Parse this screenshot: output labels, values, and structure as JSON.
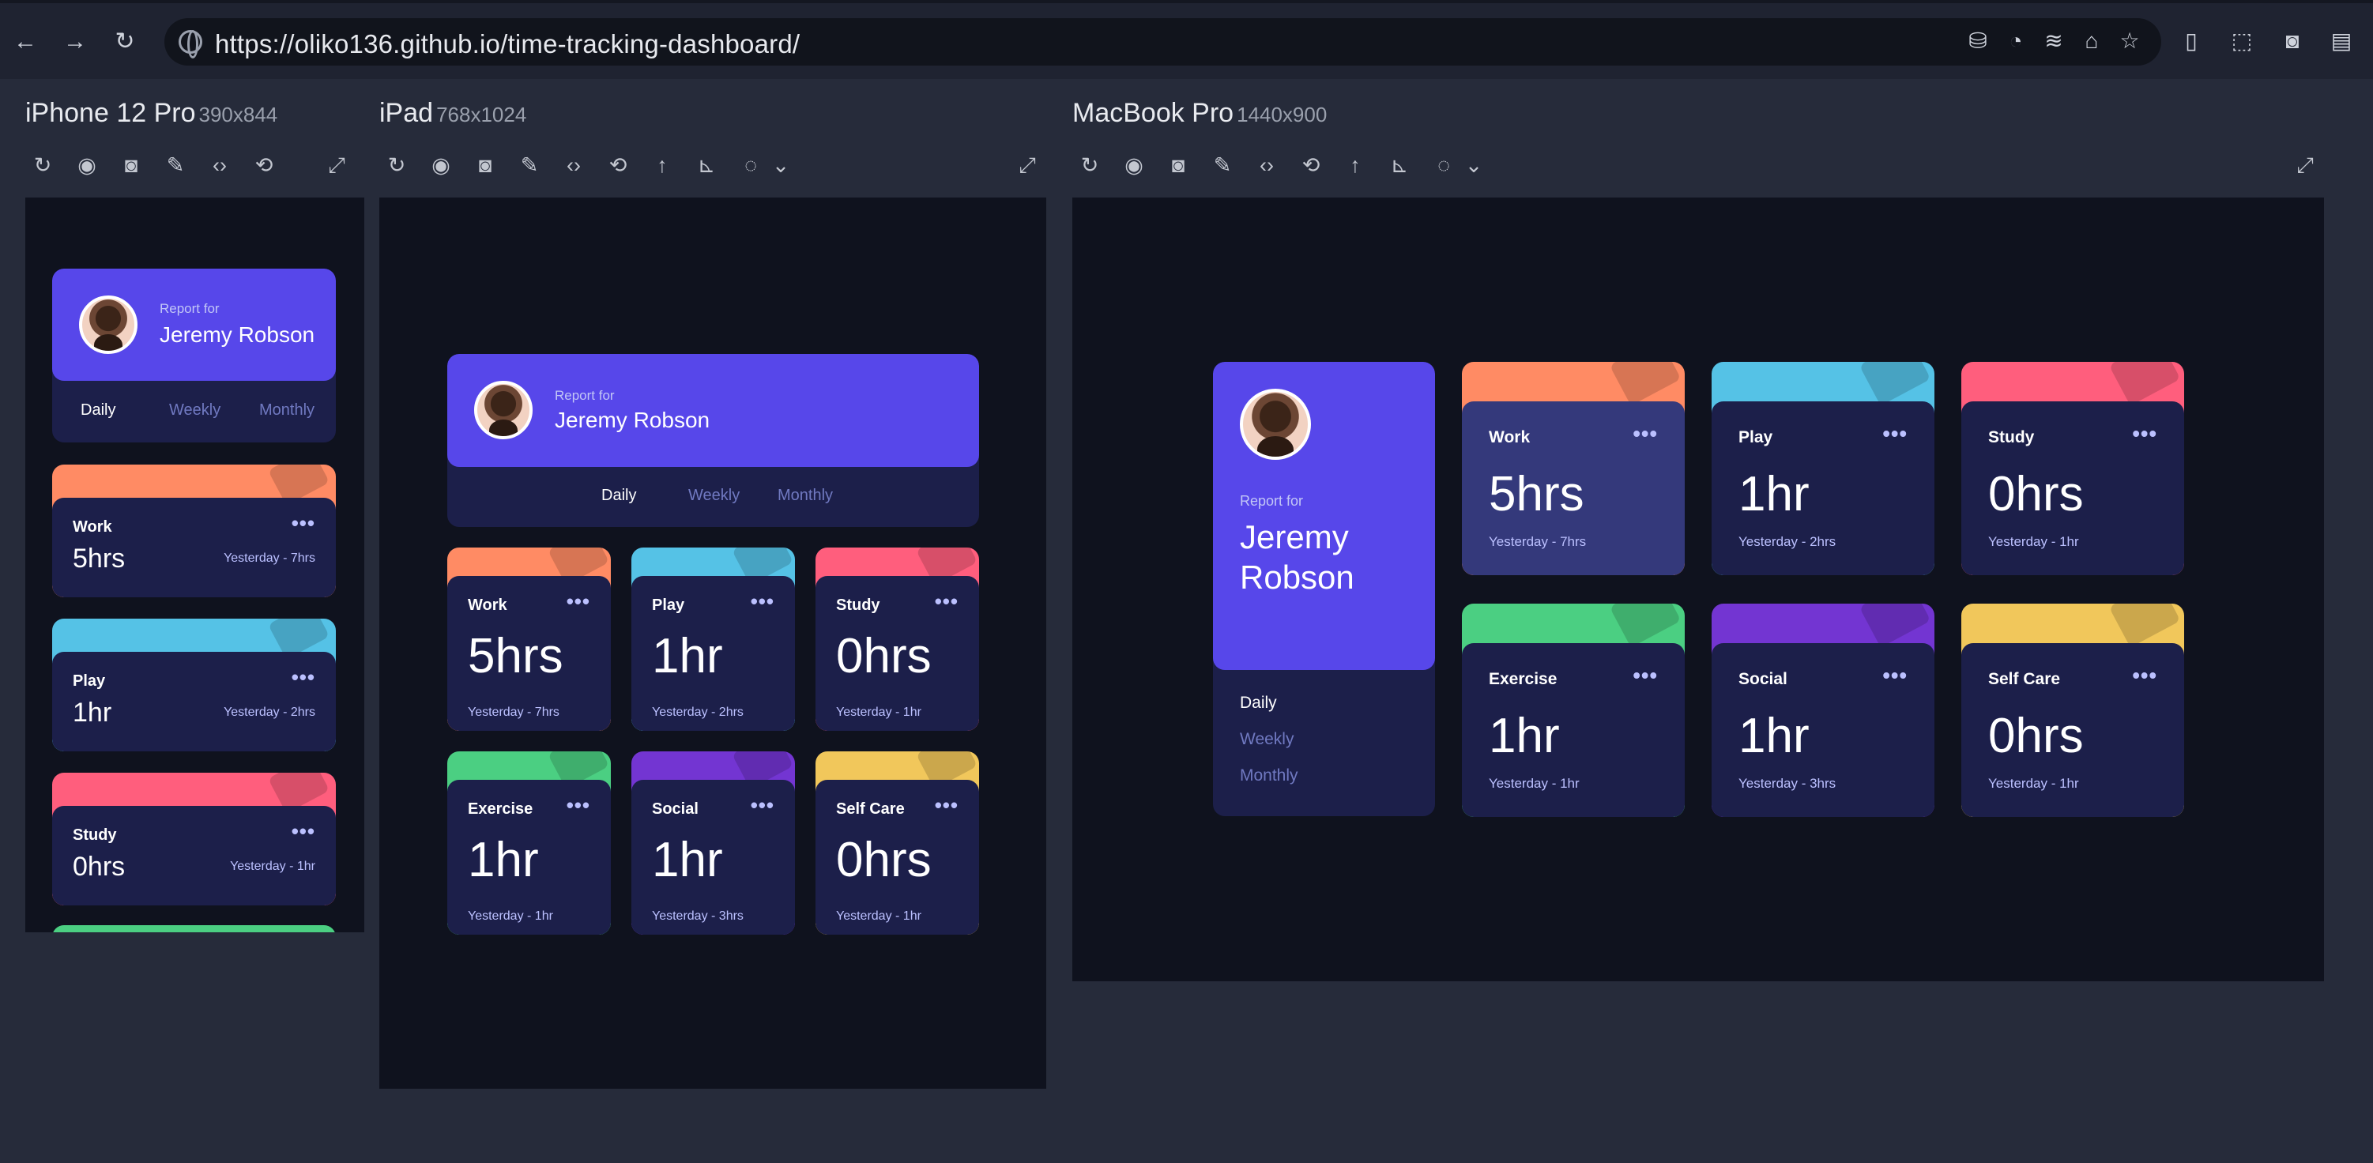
{
  "browser": {
    "url": "https://oliko136.github.io/time-tracking-dashboard/",
    "nav_icons": [
      "back-icon",
      "forward-icon",
      "reload-icon"
    ],
    "extension_icons": [
      "database-icon",
      "cookie-icon",
      "wifi-icon",
      "home-icon",
      "star-icon",
      "responsive-icon",
      "inspect-icon",
      "camera-icon",
      "document-icon"
    ]
  },
  "devices": [
    {
      "name": "iPhone 12 Pro",
      "size": "390x844"
    },
    {
      "name": "iPad",
      "size": "768x1024"
    },
    {
      "name": "MacBook Pro",
      "size": "1440x900"
    }
  ],
  "dashboard": {
    "report_for": "Report for",
    "name": "Jeremy Robson",
    "name_line1": "Jeremy",
    "name_line2": "Robson",
    "tabs": [
      "Daily",
      "Weekly",
      "Monthly"
    ],
    "active_tab": "Daily",
    "cards": [
      {
        "title": "Work",
        "current": "5hrs",
        "previous": "Yesterday - 7hrs",
        "color": "#ff8b64",
        "icon": "briefcase-icon"
      },
      {
        "title": "Play",
        "current": "1hr",
        "previous": "Yesterday - 2hrs",
        "color": "#55c2e6",
        "icon": "gamepad-icon"
      },
      {
        "title": "Study",
        "current": "0hrs",
        "previous": "Yesterday - 1hr",
        "color": "#ff5e7d",
        "icon": "book-icon"
      },
      {
        "title": "Exercise",
        "current": "1hr",
        "previous": "Yesterday - 1hr",
        "color": "#4bcf82",
        "icon": "runner-icon"
      },
      {
        "title": "Social",
        "current": "1hr",
        "previous": "Yesterday - 3hrs",
        "color": "#7335d2",
        "icon": "chat-icon"
      },
      {
        "title": "Self Care",
        "current": "0hrs",
        "previous": "Yesterday - 1hr",
        "color": "#f1c75b",
        "icon": "heart-icon"
      }
    ]
  },
  "colors": {
    "profile": "#5747ea",
    "card_body": "#1c1f4a",
    "card_hover": "#34397b",
    "page_bg": "#0f121e"
  }
}
